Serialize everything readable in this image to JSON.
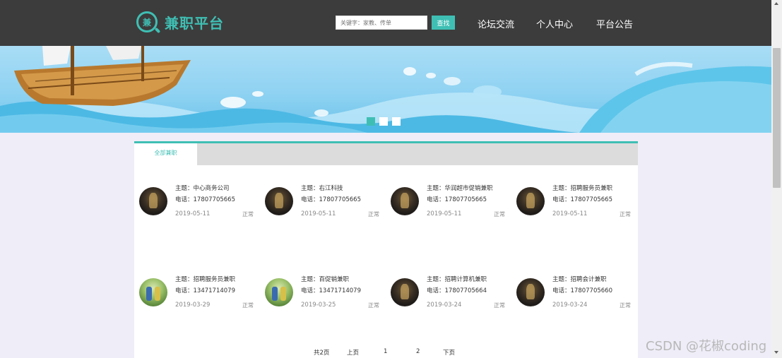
{
  "header": {
    "logo_char": "兼",
    "logo_text": "兼职平台",
    "search_placeholder": "关键字：家教、传单",
    "search_button": "查找",
    "nav": [
      "论坛交流",
      "个人中心",
      "平台公告"
    ]
  },
  "banner": {
    "slide_count": 3,
    "active_slide": 1
  },
  "tabs": {
    "active_label": "全部兼职"
  },
  "jobs": [
    {
      "title": "主题：中心商务公司",
      "phone": "电话：17807705665",
      "date": "2019-05-11",
      "status": "正常"
    },
    {
      "title": "主题：右江科技",
      "phone": "电话：17807705665",
      "date": "2019-05-11",
      "status": "正常"
    },
    {
      "title": "主题：华润超市促销兼职",
      "phone": "电话：17807705665",
      "date": "2019-05-11",
      "status": "正常"
    },
    {
      "title": "主题：招聘服务员兼职",
      "phone": "电话：17807705665",
      "date": "2019-05-11",
      "status": "正常"
    },
    {
      "title": "主题：招聘服务员兼职",
      "phone": "电话：13471714079",
      "date": "2019-03-29",
      "status": "正常"
    },
    {
      "title": "主题：百促销兼职",
      "phone": "电话：13471714079",
      "date": "2019-03-25",
      "status": "正常"
    },
    {
      "title": "主题：招聘计算机兼职",
      "phone": "电话：17807705664",
      "date": "2019-03-24",
      "status": "正常"
    },
    {
      "title": "主题：招聘会计兼职",
      "phone": "电话：17807705660",
      "date": "2019-03-24",
      "status": "正常"
    }
  ],
  "pager": {
    "total": "共2页",
    "prev": "上页",
    "page1": "1",
    "page2": "2",
    "next": "下页"
  },
  "watermark": "CSDN @花椒coding",
  "colors": {
    "accent": "#3fbfb4",
    "header_bg": "#3c3c3c",
    "page_bg": "#efedf8"
  }
}
